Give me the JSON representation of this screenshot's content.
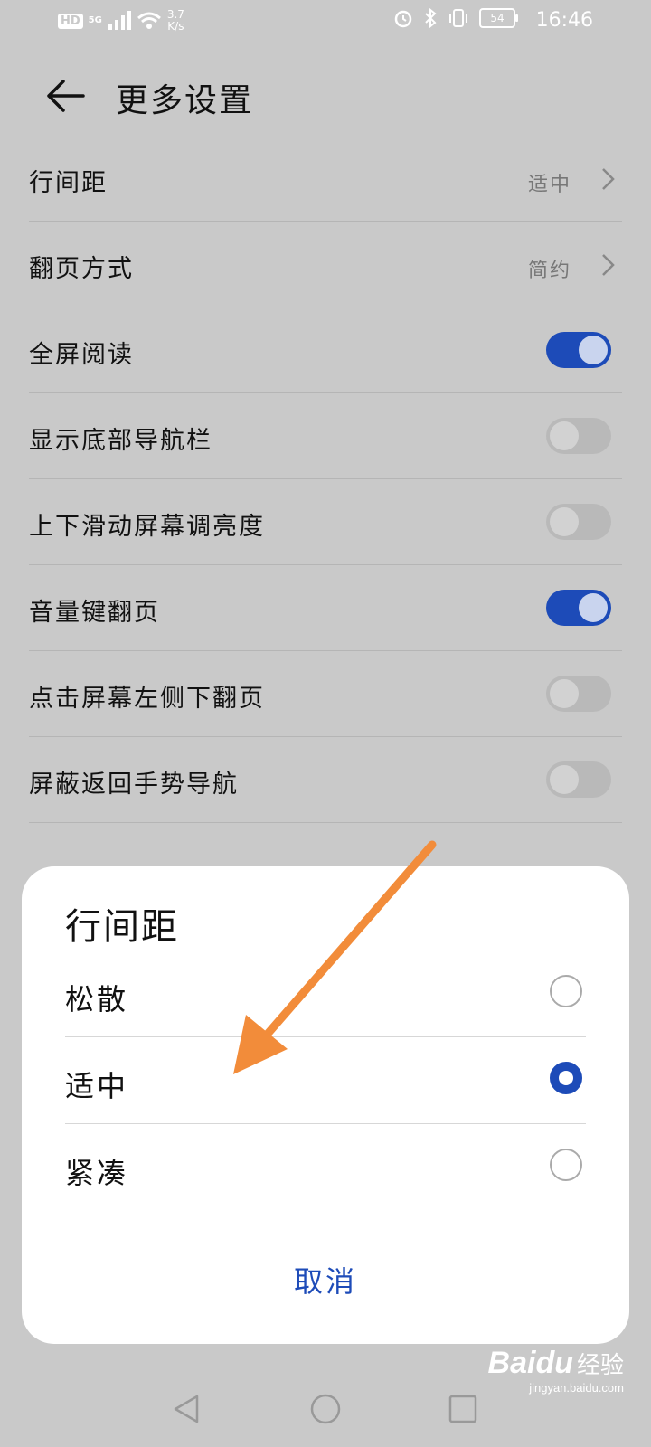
{
  "status_bar": {
    "hd": "HD",
    "network": "5G",
    "speed_value": "3.7",
    "speed_unit": "K/s",
    "battery": "54",
    "time": "16:46"
  },
  "header": {
    "title": "更多设置"
  },
  "settings": [
    {
      "label": "行间距",
      "value": "适中",
      "type": "nav"
    },
    {
      "label": "翻页方式",
      "value": "简约",
      "type": "nav"
    },
    {
      "label": "全屏阅读",
      "type": "toggle",
      "on": true
    },
    {
      "label": "显示底部导航栏",
      "type": "toggle",
      "on": false
    },
    {
      "label": "上下滑动屏幕调亮度",
      "type": "toggle",
      "on": false
    },
    {
      "label": "音量键翻页",
      "type": "toggle",
      "on": true
    },
    {
      "label": "点击屏幕左侧下翻页",
      "type": "toggle",
      "on": false
    },
    {
      "label": "屏蔽返回手势导航",
      "type": "toggle",
      "on": false
    }
  ],
  "dialog": {
    "title": "行间距",
    "options": [
      {
        "label": "松散",
        "selected": false
      },
      {
        "label": "适中",
        "selected": true
      },
      {
        "label": "紧凑",
        "selected": false
      }
    ],
    "cancel_label": "取消"
  },
  "annotation": {
    "arrow_color": "#f28c3a"
  },
  "colors": {
    "accent": "#1d4bb8",
    "background": "#c9c9c9"
  },
  "watermark": {
    "brand": "Baidu",
    "sub": "经验",
    "url": "jingyan.baidu.com"
  }
}
